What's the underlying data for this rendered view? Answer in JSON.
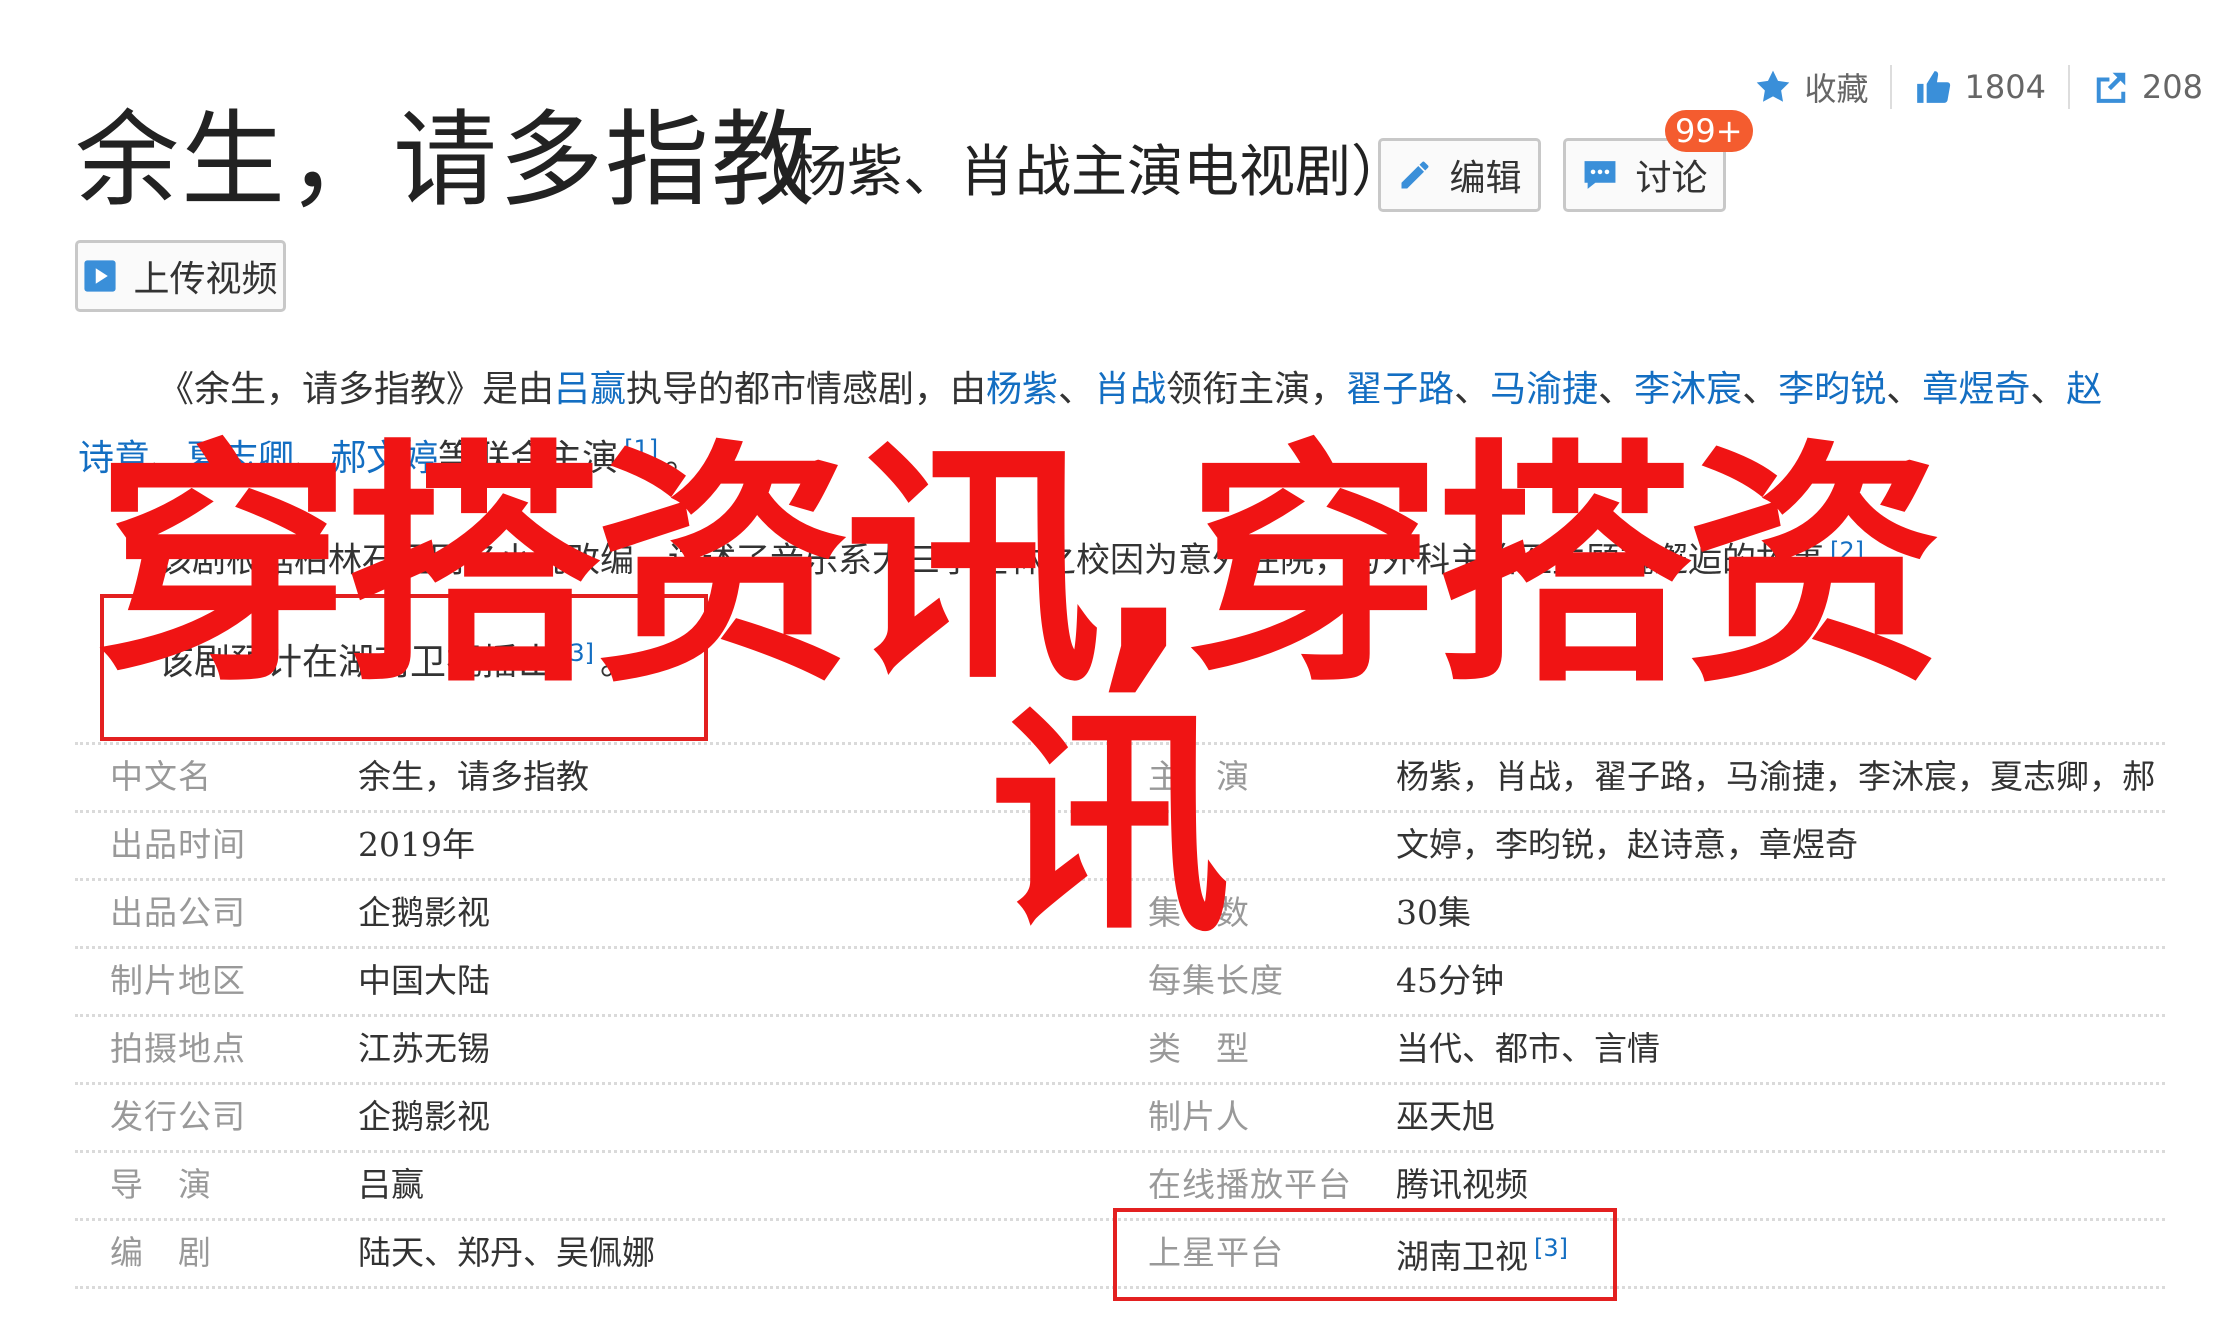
{
  "stats": {
    "favorite_label": "收藏",
    "likes_count": "1804",
    "shares_count": "208"
  },
  "header": {
    "title": "余生，请多指教",
    "subtitle": "（杨紫、肖战主演电视剧）",
    "edit_label": "编辑",
    "discuss_label": "讨论",
    "discuss_badge": "99+",
    "upload_video_label": "上传视频"
  },
  "summary": {
    "p1_prefix": "《余生，请多指教》是由",
    "director": "吕赢",
    "p1_mid": "执导的都市情感剧，由",
    "actor1": "杨紫",
    "sep1": "、",
    "actor2": "肖战",
    "p1_mid2": "领衔主演，",
    "actor3": "翟子路",
    "sep2": "、",
    "actor4": "马渝捷",
    "sep3": "、",
    "actor5": "李沐宸",
    "sep4": "、",
    "actor6": "李昀锐",
    "sep5": "、",
    "actor7": "章煜奇",
    "sep6": "、",
    "actor8a": "赵",
    "actor8b": "诗意",
    "sep7": "、",
    "actor9": "夏志卿",
    "sep8": "、",
    "actor10": "郝文婷",
    "p1_end": "等联合主演",
    "ref1": "[1]",
    "period1": "。",
    "p2_text": "该剧根据柏林石匠同名小说改编，讲述了音乐系大三学生林之校因为意外住院，与外科主治医生顾魏邂逅的故事",
    "ref2": "[2]",
    "period2": "。",
    "p3_text": "该剧预计在湖南卫视播出",
    "ref3": "[3]",
    "period3": "。"
  },
  "info_left": [
    {
      "label": "中文名",
      "value": "余生，请多指教"
    },
    {
      "label": "出品时间",
      "value": "2019年"
    },
    {
      "label": "出品公司",
      "value": "企鹅影视"
    },
    {
      "label": "制片地区",
      "value": "中国大陆"
    },
    {
      "label": "拍摄地点",
      "value": "江苏无锡"
    },
    {
      "label": "发行公司",
      "value": "企鹅影视"
    },
    {
      "label": "导　演",
      "value": "吕赢"
    },
    {
      "label": "编　剧",
      "value": "陆天、郑丹、吴佩娜"
    }
  ],
  "info_right": [
    {
      "label": "主　演",
      "value": "杨紫，肖战，翟子路，马渝捷，李沐宸，夏志卿，郝"
    },
    {
      "label": "",
      "value": "文婷，李昀锐，赵诗意，章煜奇"
    },
    {
      "label": "集　数",
      "value": "30集"
    },
    {
      "label": "每集长度",
      "value": "45分钟"
    },
    {
      "label": "类　型",
      "value": "当代、都市、言情"
    },
    {
      "label": "制片人",
      "value": "巫天旭"
    },
    {
      "label": "在线播放平台",
      "value": "腾讯视频"
    },
    {
      "label": "上星平台",
      "value": "湖南卫视",
      "ref": "[3]"
    }
  ],
  "watermark": {
    "line1": "穿搭资讯,穿搭资",
    "line2": "讯"
  },
  "colors": {
    "link": "#136ec2",
    "watermark": "#f01414",
    "badge": "#f45c2f",
    "highlight_box": "#e32020"
  }
}
